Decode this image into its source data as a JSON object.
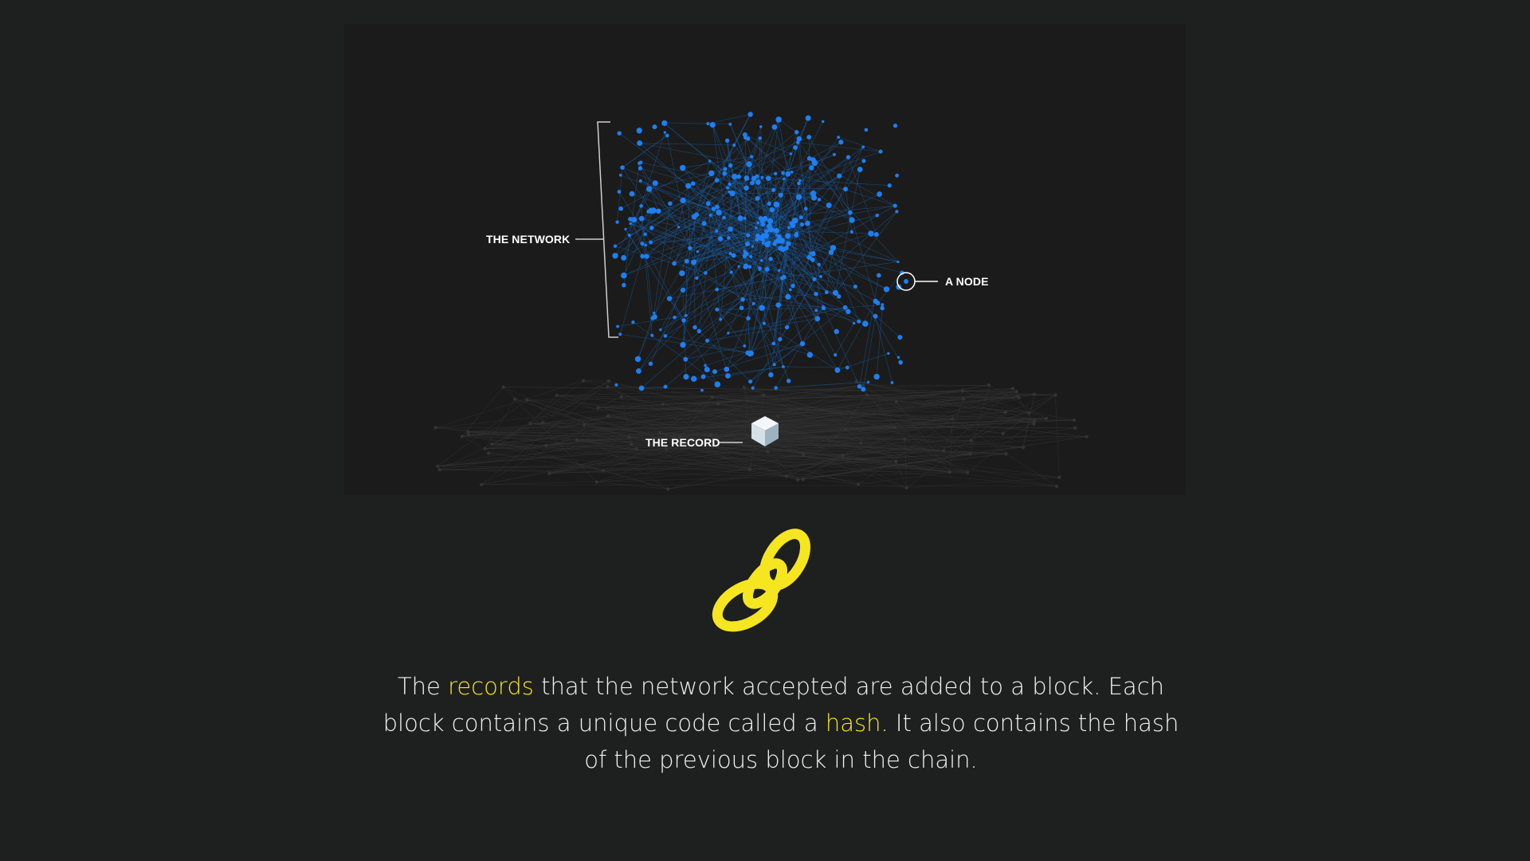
{
  "diagram": {
    "labels": {
      "network": "THE NETWORK",
      "node": "A NODE",
      "record": "THE RECORD"
    },
    "node_color": "#1f7ef0",
    "edge_color": "#1a5fa8",
    "label_color": "#ffffff"
  },
  "chain_icon": {
    "name": "chain-link-icon",
    "color": "#f5e61f"
  },
  "caption": {
    "part1": "The ",
    "highlight1": "records",
    "part2": " that the network accepted are added to a block. Each block contains a unique code called a ",
    "highlight2": "hash",
    "part3": ". It also contains the hash of the previous block in the chain.",
    "highlight_color": "#f5e61f"
  }
}
